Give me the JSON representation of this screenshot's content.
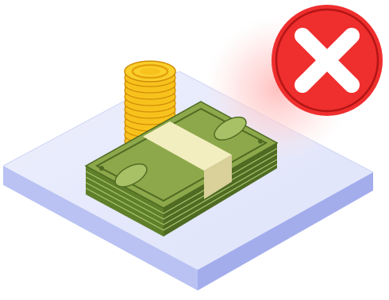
{
  "illustration": {
    "subject": "no-money",
    "icons": [
      "coin-stack-icon",
      "banknote-bundle-icon",
      "cancel-x-icon"
    ],
    "colors": {
      "platform_top": "#e4e8fb",
      "platform_side_left": "#b9c2f2",
      "platform_side_right": "#a3adec",
      "coin_gold": "#f7c21c",
      "coin_dark": "#d8970a",
      "bill_green": "#8da84a",
      "bill_dark_green": "#4f6b23",
      "band_cream": "#f3eec0",
      "cancel_red": "#ef2e2e",
      "cancel_glow": "#ffd4d4"
    }
  }
}
